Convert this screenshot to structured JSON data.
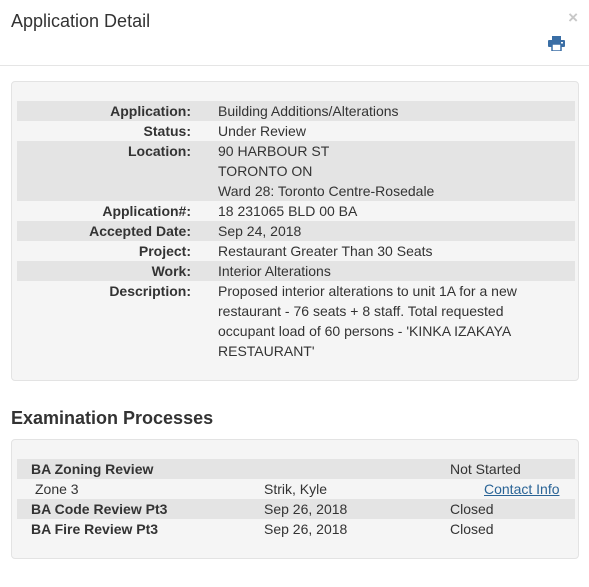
{
  "modal": {
    "title": "Application Detail",
    "close_glyph": "×"
  },
  "details": [
    {
      "label": "Application:",
      "values": [
        "Building Additions/Alterations"
      ]
    },
    {
      "label": "Status:",
      "values": [
        "Under Review"
      ]
    },
    {
      "label": "Location:",
      "values": [
        "90 HARBOUR ST",
        "TORONTO ON",
        "Ward 28: Toronto Centre-Rosedale"
      ]
    },
    {
      "label": "Application#:",
      "values": [
        "18 231065 BLD 00 BA"
      ]
    },
    {
      "label": "Accepted Date:",
      "values": [
        "Sep 24, 2018"
      ]
    },
    {
      "label": "Project:",
      "values": [
        "Restaurant Greater Than 30 Seats"
      ]
    },
    {
      "label": "Work:",
      "values": [
        "Interior Alterations"
      ]
    },
    {
      "label": "Description:",
      "values": [
        "Proposed interior alterations to unit 1A for a new",
        "restaurant - 76 seats + 8 staff. Total requested",
        "occupant load of 60 persons - 'KINKA IZAKAYA",
        "RESTAURANT'"
      ]
    }
  ],
  "exam": {
    "title": "Examination Processes",
    "rows": [
      {
        "process": "BA Zoning Review",
        "date": "",
        "status": "Not Started",
        "link": ""
      },
      {
        "process": "Zone 3",
        "date": "Strik, Kyle",
        "status": "",
        "link": "Contact Info"
      },
      {
        "process": "BA Code Review Pt3",
        "date": "Sep 26, 2018",
        "status": "Closed",
        "link": ""
      },
      {
        "process": "BA Fire Review Pt3",
        "date": "Sep 26, 2018",
        "status": "Closed",
        "link": ""
      }
    ]
  },
  "icons": {
    "close": "close-icon",
    "print": "print-icon"
  },
  "colors": {
    "link": "#2a6496",
    "shaded_row": "#e4e4e4",
    "well_bg": "#f5f5f5"
  }
}
